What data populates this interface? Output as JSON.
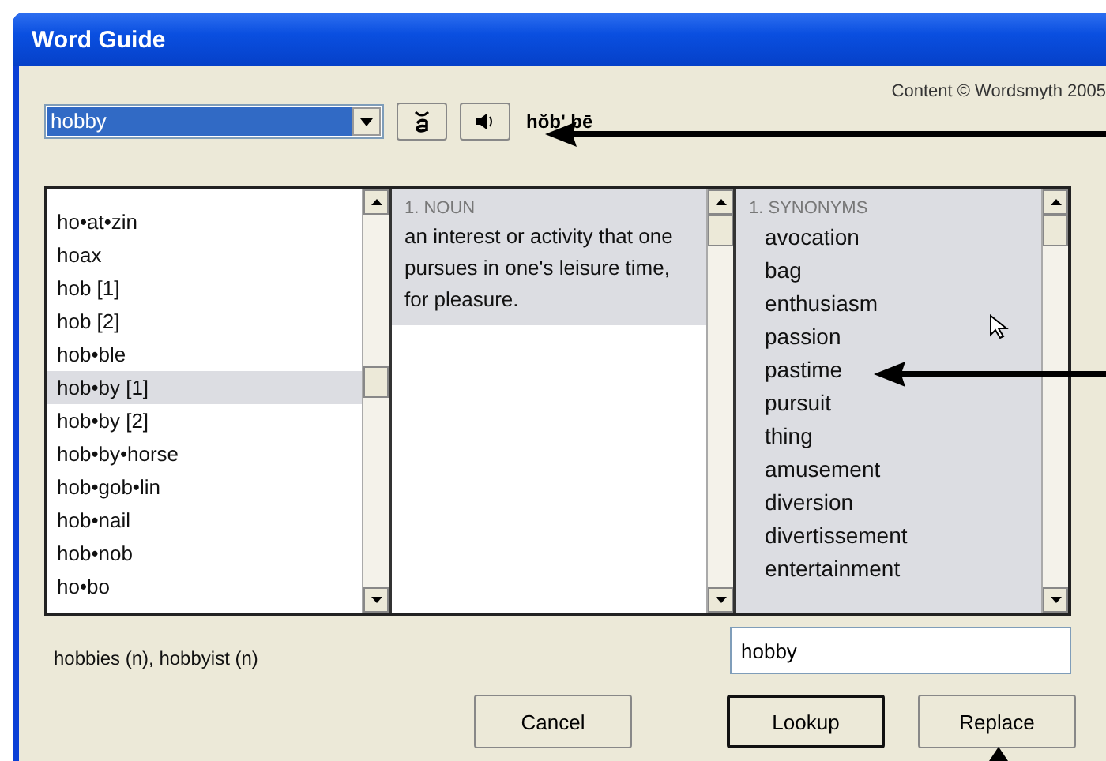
{
  "window": {
    "title": "Word Guide"
  },
  "copyright": "Content © Wordsmyth 2005",
  "search": {
    "value": "hobby"
  },
  "pronunciation": "hŏb' bē",
  "words": [
    {
      "label": "ho•at•zin",
      "selected": false
    },
    {
      "label": "hoax",
      "selected": false
    },
    {
      "label": "hob [1]",
      "selected": false
    },
    {
      "label": "hob [2]",
      "selected": false
    },
    {
      "label": "hob•ble",
      "selected": false
    },
    {
      "label": "hob•by [1]",
      "selected": true
    },
    {
      "label": "hob•by [2]",
      "selected": false
    },
    {
      "label": "hob•by•horse",
      "selected": false
    },
    {
      "label": "hob•gob•lin",
      "selected": false
    },
    {
      "label": "hob•nail",
      "selected": false
    },
    {
      "label": "hob•nob",
      "selected": false
    },
    {
      "label": "ho•bo",
      "selected": false
    }
  ],
  "definitions": [
    {
      "sense": "1. NOUN",
      "text": "an interest or activity that one pursues in one's leisure time, for pleasure.",
      "selected": true
    }
  ],
  "synonyms": {
    "heading": "1. SYNONYMS",
    "items": [
      "avocation",
      "bag",
      "enthusiasm",
      "passion",
      "pastime",
      "pursuit",
      "thing",
      "amusement",
      "diversion",
      "divertissement",
      "entertainment"
    ]
  },
  "forms": "hobbies (n), hobbyist (n)",
  "replacement": {
    "value": "hobby"
  },
  "buttons": [
    {
      "label": "Cancel",
      "default": false
    },
    {
      "label": "Lookup",
      "default": true
    },
    {
      "label": "Replace",
      "default": false
    }
  ]
}
